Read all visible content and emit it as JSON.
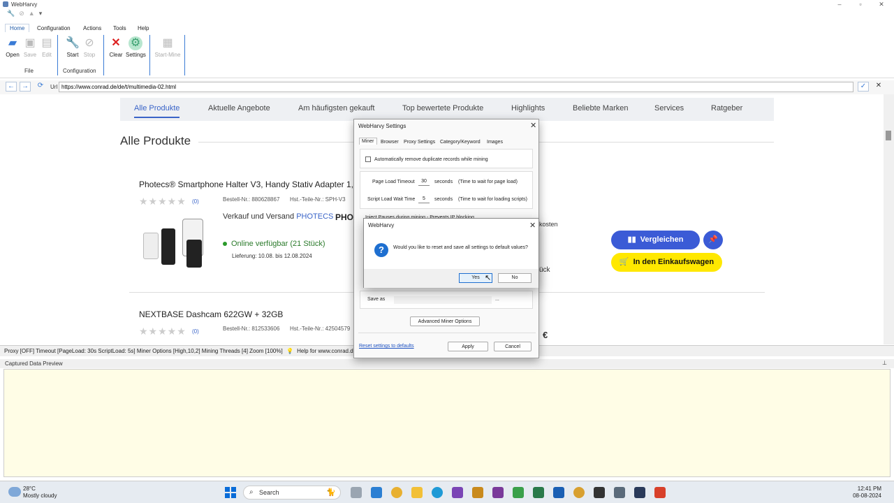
{
  "app": {
    "title": "WebHarvy"
  },
  "ribbon": {
    "tabs": [
      "Home",
      "Configuration",
      "Actions",
      "Tools",
      "Help"
    ],
    "buttons": {
      "open": "Open",
      "save": "Save",
      "edit": "Edit",
      "start": "Start",
      "stop": "Stop",
      "clear": "Clear",
      "settings": "Settings",
      "start_mine": "Start-Mine"
    },
    "groups": {
      "file": "File",
      "configuration": "Configuration"
    }
  },
  "urlbar": {
    "label": "Url",
    "value": "https://www.conrad.de/de/t/multimedia-02.html"
  },
  "webpage": {
    "nav_tabs": [
      "Alle Produkte",
      "Aktuelle Angebote",
      "Am häufigsten gekauft",
      "Top bewertete Produkte",
      "Highlights",
      "Beliebte Marken",
      "Services",
      "Ratgeber"
    ],
    "page_title": "Alle Produkte",
    "product1": {
      "title": "Photecs® Smartphone Halter V3, Handy Stativ Adapter 1,",
      "stars": "★★★★★",
      "reviews": "(0)",
      "order_no": "Bestell-Nr.: 880628867",
      "mfr_no": "Hst.-Teile-Nr.: SPH-V3",
      "seller_prefix": "Verkauf und Versand",
      "seller_brand": "PHOTECS",
      "logo_text": "PHO",
      "availability": "Online verfügbar (21 Stück)",
      "delivery": "Lieferung: 10.08. bis 12.08.2024",
      "shipping_cutoff": "kosten",
      "stock_cutoff": "ück",
      "compare_btn": "Vergleichen",
      "cart_btn": "In den Einkaufswagen"
    },
    "product2": {
      "title": "NEXTBASE Dashcam 622GW + 32GB",
      "stars": "★★★★★",
      "reviews": "(0)",
      "order_no": "Bestell-Nr.: 812533606",
      "mfr_no": "Hst.-Teile-Nr.: 42504579",
      "price_cutoff": "€"
    }
  },
  "statusbar": {
    "text": "Proxy [OFF] Timeout [PageLoad: 30s ScriptLoad: 5s] Miner Options [High,10,2] Mining Threads [4] Zoom [100%]",
    "help": "Help for www.conrad.de"
  },
  "preview": {
    "title": "Captured Data Preview"
  },
  "settings_dialog": {
    "title": "WebHarvy Settings",
    "tabs": [
      "Miner",
      "Browser",
      "Proxy Settings",
      "Category/Keyword",
      "Images"
    ],
    "remove_duplicates": "Automatically remove duplicate records while mining",
    "page_load_label": "Page Load Timeout",
    "page_load_value": "30",
    "page_load_unit": "seconds",
    "page_load_hint": "(Time to wait for page load)",
    "script_load_label": "Script Load Wait Time",
    "script_load_value": "5",
    "script_load_unit": "seconds",
    "script_load_hint": "(Time to wait for loading scripts)",
    "inject_pauses": "Inject Pauses during mining - Prevents IP blocking",
    "save_as": "Save as",
    "browse": "...",
    "advanced_btn": "Advanced Miner Options",
    "reset_link": "Reset settings to defaults",
    "apply_btn": "Apply",
    "cancel_btn": "Cancel"
  },
  "confirm_dialog": {
    "title": "WebHarvy",
    "message": "Would you like to reset and save all settings to default values?",
    "yes": "Yes",
    "no": "No"
  },
  "taskbar": {
    "temp": "28°C",
    "weather": "Mostly cloudy",
    "search": "Search",
    "time": "12:41 PM",
    "date": "08-08-2024"
  },
  "colors": {
    "accent": "#3a64c8",
    "compare_btn": "#3b5bd6",
    "cart_btn": "#ffe800",
    "preview_bg": "#fffde6"
  }
}
